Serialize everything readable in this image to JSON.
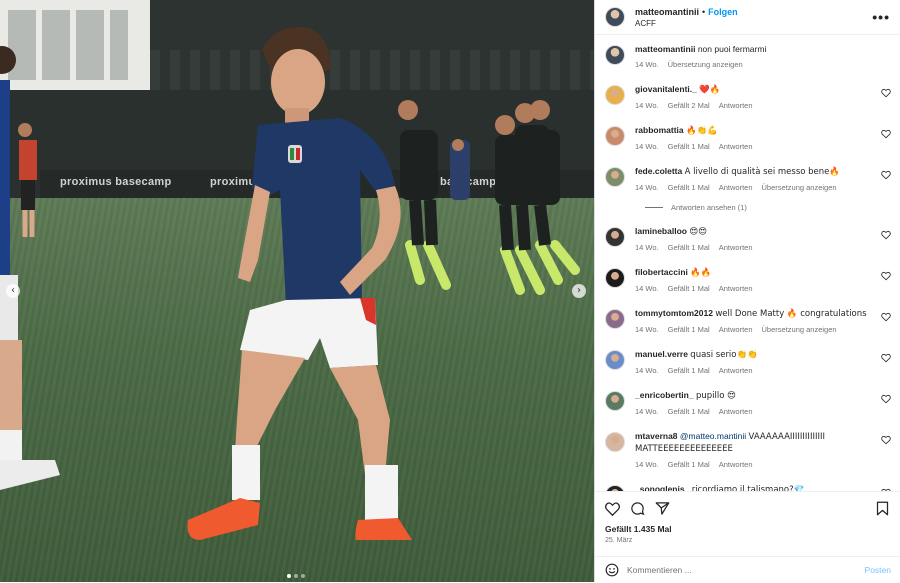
{
  "post": {
    "username": "matteomantinii",
    "separator": "•",
    "follow_label": "Folgen",
    "location": "ACFF",
    "more_label": "•••"
  },
  "media": {
    "banner_texts": [
      "proximus basecamp",
      "proximus",
      "basecamp"
    ],
    "prev_arrow": "‹",
    "next_arrow": "›"
  },
  "caption": {
    "username": "matteomantinii",
    "text": "non puoi fermarmi",
    "age": "14 Wo.",
    "translate": "Übersetzung anzeigen"
  },
  "comments": [
    {
      "username": "giovanitalenti._",
      "text": "❤️🔥",
      "age": "14 Wo.",
      "likes": "Gefällt 2 Mal",
      "reply": "Antworten",
      "translate": ""
    },
    {
      "username": "rabbomattia",
      "text": "🔥👏💪",
      "age": "14 Wo.",
      "likes": "Gefällt 1 Mal",
      "reply": "Antworten",
      "translate": ""
    },
    {
      "username": "fede.coletta",
      "text": "A livello di qualità sei messo bene🔥",
      "age": "14 Wo.",
      "likes": "Gefällt 1 Mal",
      "reply": "Antworten",
      "translate": "Übersetzung anzeigen"
    },
    {
      "username": "lamineballoo",
      "text": "😍😍",
      "age": "14 Wo.",
      "likes": "Gefällt 1 Mal",
      "reply": "Antworten",
      "translate": ""
    },
    {
      "username": "filobertaccini",
      "text": "🔥🔥",
      "age": "14 Wo.",
      "likes": "Gefällt 1 Mal",
      "reply": "Antworten",
      "translate": ""
    },
    {
      "username": "tommytomtom2012",
      "text": "well Done Matty 🔥 congratulations",
      "age": "14 Wo.",
      "likes": "Gefällt 1 Mal",
      "reply": "Antworten",
      "translate": "Übersetzung anzeigen"
    },
    {
      "username": "manuel.verre",
      "text": "quasi serio👏👏",
      "age": "14 Wo.",
      "likes": "Gefällt 1 Mal",
      "reply": "Antworten",
      "translate": ""
    },
    {
      "username": "_enricobertin_",
      "text": "pupillo 😍",
      "age": "14 Wo.",
      "likes": "Gefällt 1 Mal",
      "reply": "Antworten",
      "translate": ""
    },
    {
      "username": "mtaverna8",
      "mention": "@matteo.mantinii",
      "text": "VAAAAAAIIIIIIIIIIIIII MATTEEEEEEEEEEEEEE",
      "age": "14 Wo.",
      "likes": "Gefällt 1 Mal",
      "reply": "Antworten",
      "translate": ""
    },
    {
      "username": "_sonoglenis_",
      "text": "ricordiamo il talismano?💎",
      "age": "",
      "likes": "",
      "reply": "",
      "translate": ""
    }
  ],
  "view_replies": "Antworten ansehen (1)",
  "footer": {
    "likes": "Gefällt 1.435 Mal",
    "date": "25. März",
    "comment_placeholder": "Kommentieren ...",
    "post_label": "Posten"
  }
}
